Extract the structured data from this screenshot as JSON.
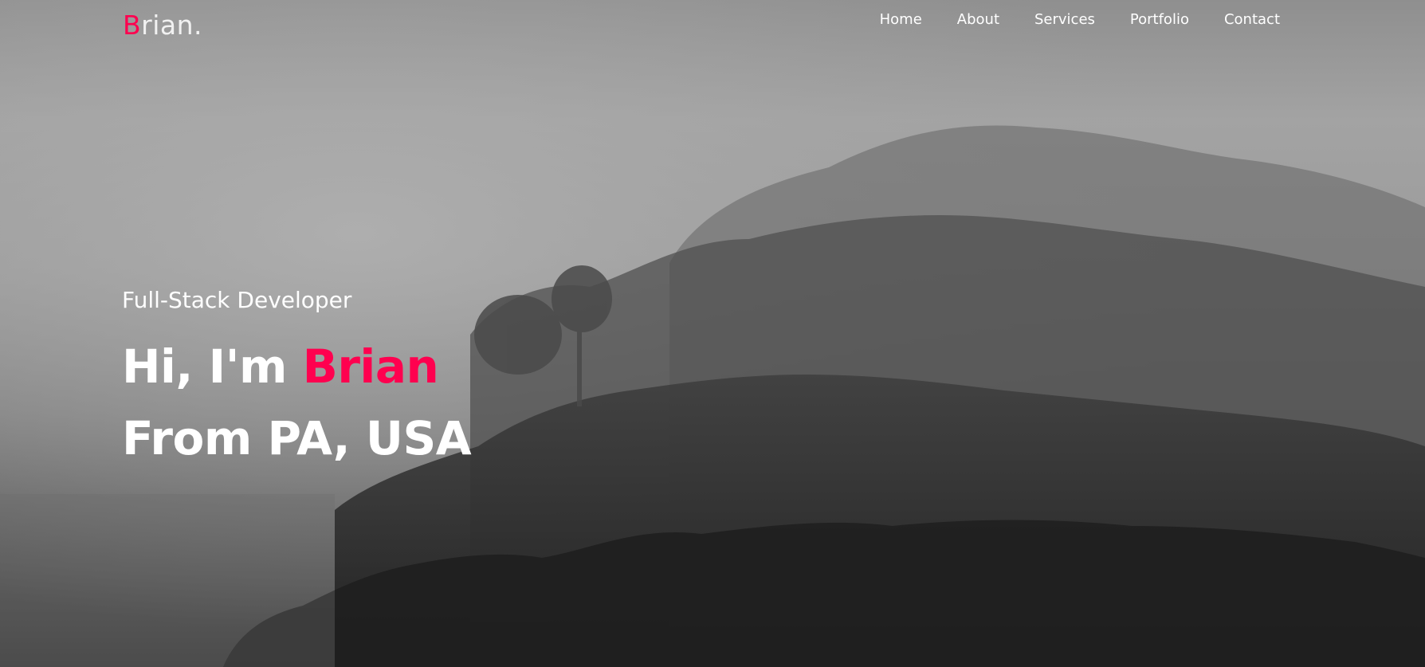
{
  "logo": {
    "initial": "B",
    "rest": "rian."
  },
  "nav": {
    "items": [
      "Home",
      "About",
      "Services",
      "Portfolio",
      "Contact"
    ]
  },
  "hero": {
    "subtitle": "Full-Stack Developer",
    "greeting": "Hi, I'm ",
    "name": "Brian",
    "location": "From PA, USA"
  },
  "colors": {
    "accent": "#ff004f",
    "text": "#ffffff"
  }
}
